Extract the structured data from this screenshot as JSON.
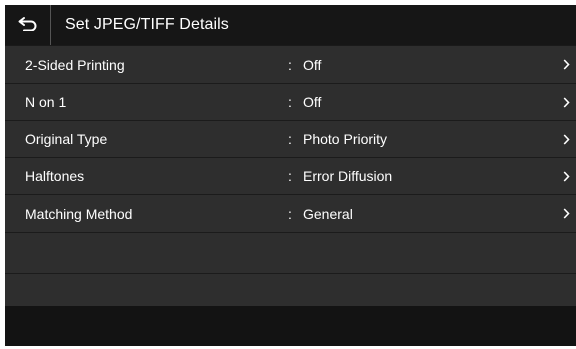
{
  "header": {
    "title": "Set JPEG/TIFF Details",
    "back_icon": "return-arrow-icon"
  },
  "settings": [
    {
      "label": "2-Sided Printing",
      "separator": ":",
      "value": "Off",
      "icon": "chevron-right-icon"
    },
    {
      "label": "N on 1",
      "separator": ":",
      "value": "Off",
      "icon": "chevron-right-icon"
    },
    {
      "label": "Original Type",
      "separator": ":",
      "value": "Photo Priority",
      "icon": "chevron-right-icon"
    },
    {
      "label": "Halftones",
      "separator": ":",
      "value": "Error Diffusion",
      "icon": "chevron-right-icon"
    },
    {
      "label": "Matching Method",
      "separator": ":",
      "value": "General",
      "icon": "chevron-right-icon"
    }
  ],
  "colors": {
    "background": "#2e2e2e",
    "header": "#161616",
    "footer": "#131313",
    "text": "#ffffff"
  }
}
